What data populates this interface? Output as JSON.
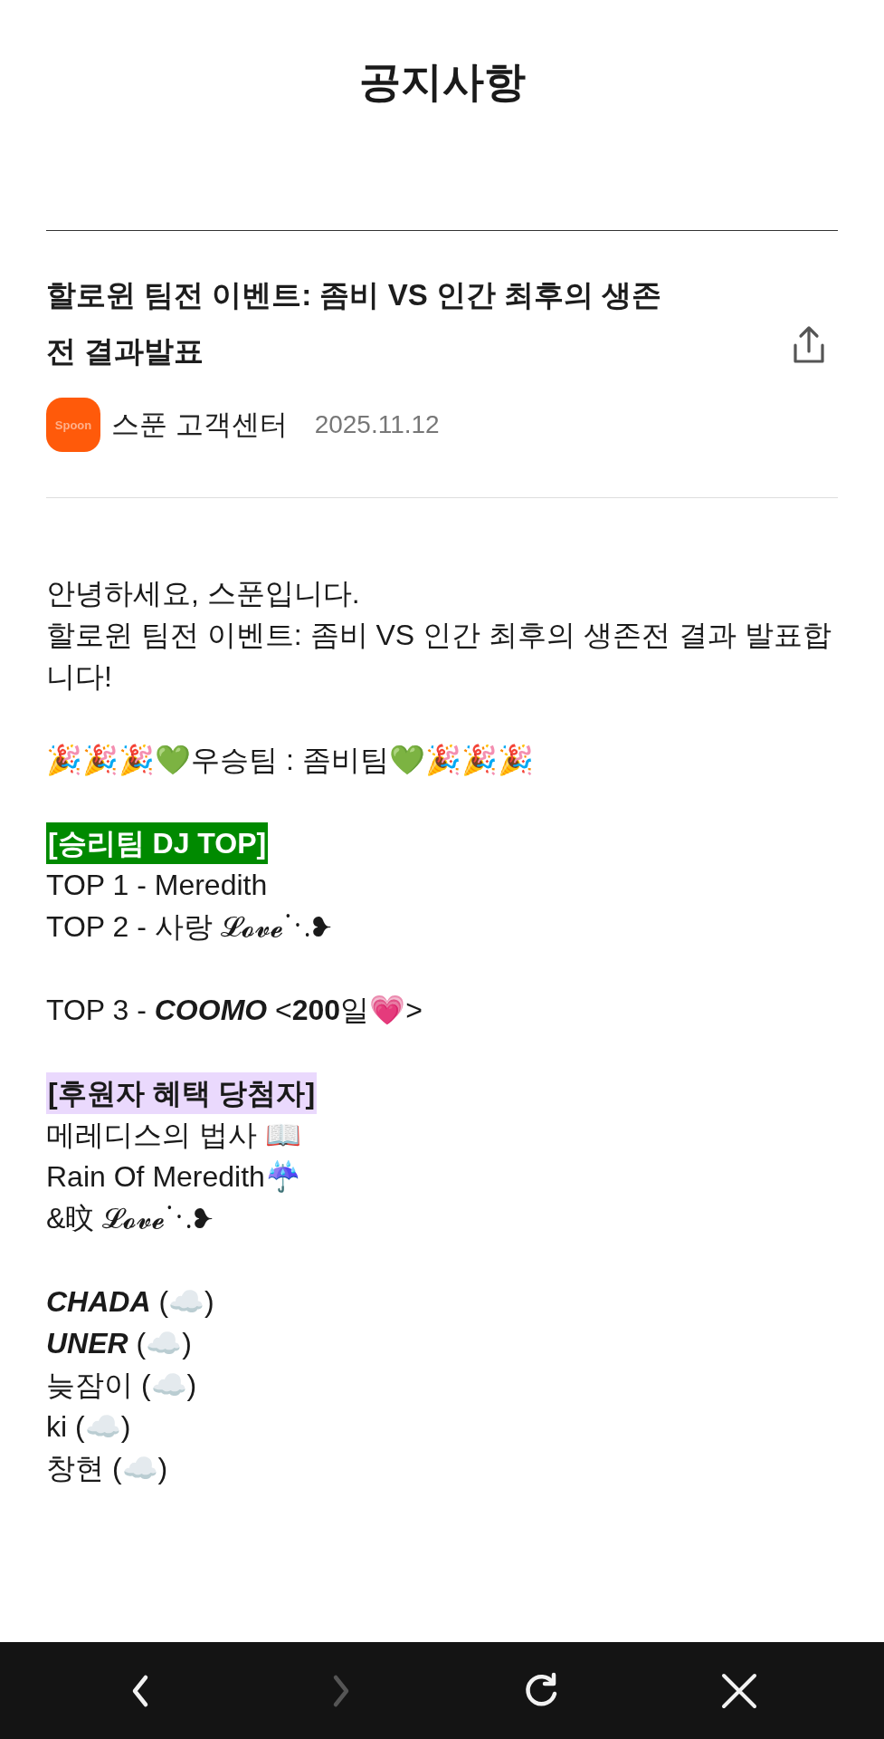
{
  "page_title": "공지사항",
  "post": {
    "title": "할로윈 팀전 이벤트: 좀비 VS 인간 최후의 생존전 결과발표",
    "author": {
      "logo_text": "Spoon",
      "name": "스푼 고객센터"
    },
    "date": "2025.11.12"
  },
  "body": {
    "paragraphs": [
      {
        "lines": [
          {
            "kind": "text",
            "text": "안녕하세요, 스푼입니다."
          },
          {
            "kind": "text",
            "text": "할로윈 팀전 이벤트: 좀비 VS 인간 최후의 생존전 결과 발표합니다!"
          }
        ]
      },
      {
        "lines": [
          {
            "kind": "text",
            "text": "🎉🎉🎉💚우승팀 : 좀비팀💚🎉🎉🎉"
          }
        ]
      },
      {
        "lines": [
          {
            "kind": "heading",
            "text": "[승리팀 DJ TOP]",
            "color": "#008a00"
          },
          {
            "kind": "text",
            "text": "TOP 1 - Meredith"
          },
          {
            "kind": "text",
            "text": "TOP 2 - 사랑 𝓛𝓸𝓿𝓮⋱❥"
          }
        ]
      },
      {
        "lines": [
          {
            "kind": "text",
            "text": "TOP 3 - *COOMO* <**200**일💗>"
          }
        ]
      },
      {
        "lines": [
          {
            "kind": "heading",
            "text": "[후원자 혜택 당첨자]",
            "color": "#ead9fd"
          },
          {
            "kind": "text",
            "text": "메레디스의 법사 📖"
          },
          {
            "kind": "text",
            "text": "Rain Of Meredith☔"
          },
          {
            "kind": "text",
            "text": "&旼 𝓛𝓸𝓿𝓮⋱❥"
          }
        ]
      },
      {
        "lines": [
          {
            "kind": "text",
            "text": "*CHADA* (☁️)"
          },
          {
            "kind": "text",
            "text": "*UNER* (☁️)"
          },
          {
            "kind": "text",
            "text": "늦잠이 (☁️)"
          },
          {
            "kind": "text",
            "text": "ki (☁️)"
          },
          {
            "kind": "text",
            "text": "창현 (☁️)"
          }
        ]
      }
    ]
  },
  "nav_bar": {
    "buttons": [
      {
        "kind": "back",
        "disabled": false
      },
      {
        "kind": "forward",
        "disabled": true
      },
      {
        "kind": "reload",
        "disabled": false
      },
      {
        "kind": "close",
        "disabled": false
      }
    ]
  }
}
